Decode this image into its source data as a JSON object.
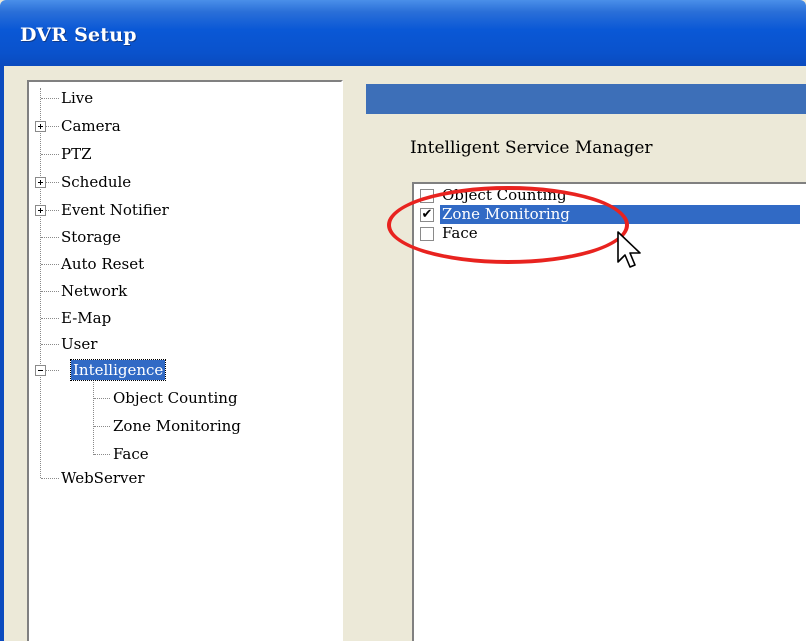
{
  "window": {
    "title": "DVR Setup"
  },
  "tree": {
    "items": [
      {
        "label": "Live",
        "expander": ""
      },
      {
        "label": "Camera",
        "expander": "plus"
      },
      {
        "label": "PTZ",
        "expander": ""
      },
      {
        "label": "Schedule",
        "expander": "plus"
      },
      {
        "label": "Event Notifier",
        "expander": "plus"
      },
      {
        "label": "Storage",
        "expander": ""
      },
      {
        "label": "Auto Reset",
        "expander": ""
      },
      {
        "label": "Network",
        "expander": ""
      },
      {
        "label": "E-Map",
        "expander": ""
      },
      {
        "label": "User",
        "expander": ""
      },
      {
        "label": "Intelligence",
        "expander": "minus",
        "selected": true
      },
      {
        "label": "Object Counting",
        "child": true
      },
      {
        "label": "Zone Monitoring",
        "child": true
      },
      {
        "label": "Face",
        "child": true
      },
      {
        "label": "WebServer",
        "expander": ""
      }
    ]
  },
  "main": {
    "section_label": "Intelligent Service Manager",
    "services": [
      {
        "label": "Object Counting",
        "checked": false
      },
      {
        "label": "Zone Monitoring",
        "checked": true,
        "highlighted": true
      },
      {
        "label": "Face",
        "checked": false
      }
    ]
  },
  "colors": {
    "selection": "#316ac5",
    "annotation": "#e8231f",
    "header_strip": "#3d6fb8"
  }
}
